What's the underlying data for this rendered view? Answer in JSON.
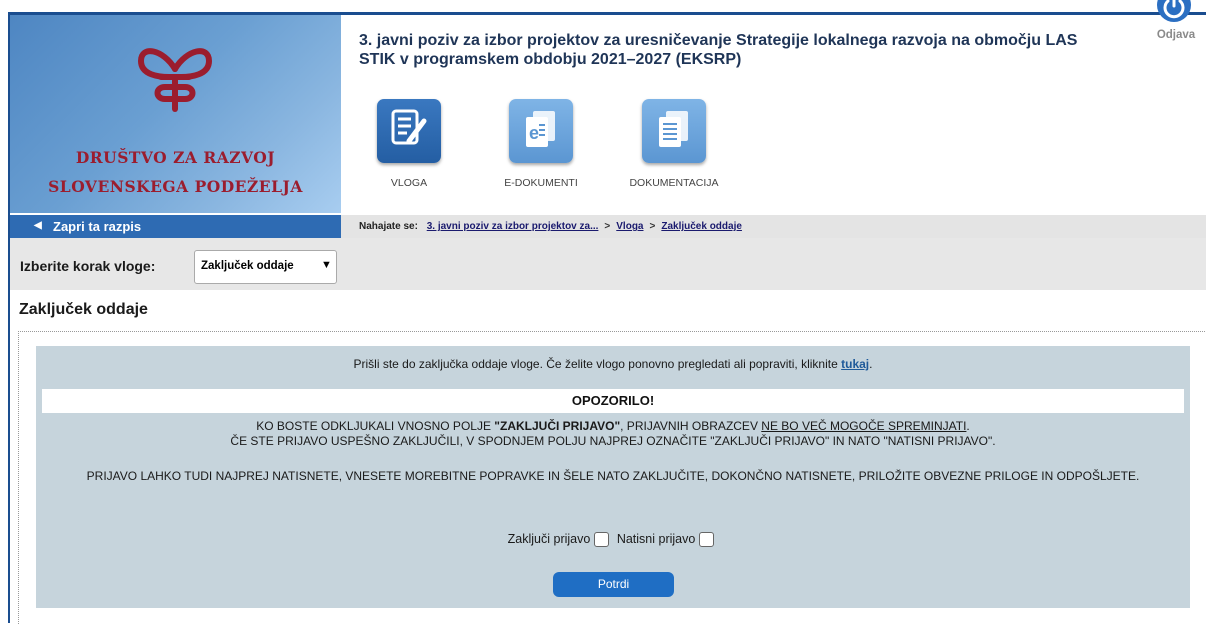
{
  "header": {
    "org_line1": "DRUŠTVO ZA RAZVOJ",
    "org_line2": "SLOVENSKEGA PODEŽELJA",
    "title": "3. javni poziv za izbor projektov za uresničevanje Strategije lokalnega razvoja na območju LAS STIK v programskem obdobju 2021–2027 (EKSRP)",
    "logout_label": "Odjava",
    "nav": [
      {
        "label": "VLOGA",
        "icon": "form-pencil-icon"
      },
      {
        "label": "E-DOKUMENTI",
        "icon": "e-document-icon"
      },
      {
        "label": "DOKUMENTACIJA",
        "icon": "documents-icon"
      }
    ]
  },
  "back_label": "Zapri ta razpis",
  "breadcrumb": {
    "lead": "Nahajate se:",
    "items": [
      "3. javni poziv za izbor projektov za...",
      "Vloga",
      "Zaključek oddaje"
    ],
    "separator": ">"
  },
  "step": {
    "label": "Izberite korak vloge:",
    "selected": "Zaključek oddaje"
  },
  "page_title": "Zaključek oddaje",
  "panel": {
    "intro_text": "Prišli ste do zaključka oddaje vloge. Če želite vlogo ponovno pregledati ali popraviti, kliknite",
    "intro_link": "tukaj",
    "intro_end": ".",
    "warning_title": "OPOZORILO!",
    "p1_a": "KO BOSTE ODKLJUKALI VNOSNO POLJE ",
    "p1_b": "\"ZAKLJUČI PRIJAVO\"",
    "p1_c": ", PRIJAVNIH OBRAZCEV ",
    "p1_d": "NE BO VEČ MOGOČE SPREMINJATI",
    "p1_e": ".",
    "p2": "ČE STE PRIJAVO USPEŠNO ZAKLJUČILI, V SPODNJEM POLJU NAJPREJ OZNAČITE \"ZAKLJUČI PRIJAVO\" IN NATO \"NATISNI PRIJAVO\".",
    "p3": "PRIJAVO LAHKO TUDI NAJPREJ NATISNETE, VNESETE MOREBITNE POPRAVKE IN ŠELE NATO ZAKLJUČITE, DOKONČNO NATISNETE, PRILOŽITE OBVEZNE PRILOGE IN ODPOŠLJETE.",
    "check1_label": "Zaključi prijavo",
    "check2_label": "Natisni prijavo",
    "check1_checked": false,
    "check2_checked": false,
    "submit_label": "Potrdi"
  },
  "colors": {
    "accent_blue": "#2e6bb3",
    "logo_red": "#9b1d2e",
    "panel_bg": "#c6d4dc",
    "button_blue": "#1f6ec4"
  }
}
